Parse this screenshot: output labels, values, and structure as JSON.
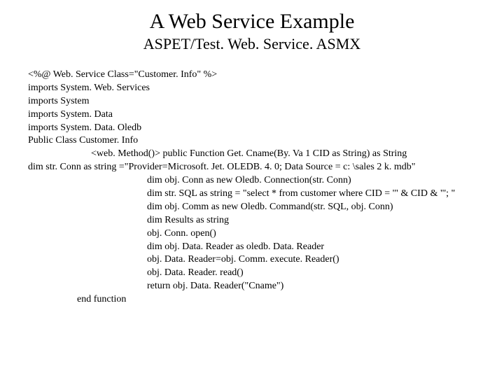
{
  "header": {
    "title": "A Web Service Example",
    "subtitle": "ASPET/Test. Web. Service. ASMX"
  },
  "code": {
    "l01": "<%@ Web. Service Class=\"Customer. Info\" %>",
    "l02": "imports System. Web. Services",
    "l03": "imports System",
    "l04": "imports System. Data",
    "l05": "imports System. Data. Oledb",
    "l06": "Public Class Customer. Info",
    "l07": "<web. Method()> public Function Get. Cname(By. Va 1 CID as String) as String",
    "l08": "dim str. Conn as string =\"Provider=Microsoft. Jet. OLEDB. 4. 0; Data Source = c: \\sales 2 k. mdb\"",
    "l09": "dim obj. Conn as new Oledb. Connection(str. Conn)",
    "l10": "dim str. SQL as string = \"select * from customer where CID = '\" & CID & \"'; \"",
    "l11": "dim obj. Comm as new Oledb. Command(str. SQL, obj. Conn)",
    "l12": "dim Results as string",
    "l13": "obj. Conn. open()",
    "l14": "dim obj. Data. Reader as oledb. Data. Reader",
    "l15": "obj. Data. Reader=obj. Comm. execute. Reader()",
    "l16": "obj. Data. Reader. read()",
    "l17": "return obj. Data. Reader(\"Cname\")",
    "l18": "end function"
  }
}
